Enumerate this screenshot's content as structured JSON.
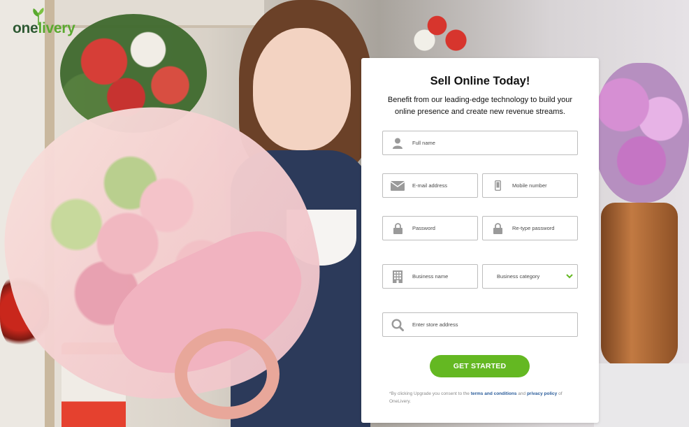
{
  "brand": {
    "logo_one": "one",
    "logo_livery": "livery",
    "colors": {
      "dark_green": "#2f5a34",
      "light_green": "#5aa92f",
      "button_green": "#64b822",
      "link_blue": "#2a5c9a"
    }
  },
  "form": {
    "title": "Sell Online Today!",
    "subtitle": "Benefit from our leading-edge technology to build your online presence and create new revenue streams.",
    "fields": {
      "full_name": {
        "placeholder": "Full name",
        "icon": "user-icon"
      },
      "email": {
        "placeholder": "E-mail address",
        "icon": "envelope-icon"
      },
      "mobile": {
        "placeholder": "Mobile number",
        "icon": "phone-icon"
      },
      "password": {
        "placeholder": "Password",
        "icon": "lock-icon"
      },
      "retype_password": {
        "placeholder": "Re-type password",
        "icon": "lock-icon"
      },
      "business_name": {
        "placeholder": "Business name",
        "icon": "building-icon"
      },
      "business_category": {
        "value": "Business category",
        "icon": "chevron-down-icon"
      },
      "store_address": {
        "placeholder": "Enter store address",
        "icon": "search-icon"
      }
    },
    "submit_label": "GET STARTED",
    "legal": {
      "prefix": "*By clicking Upgrade you consent to the",
      "terms_link": "terms and conditions",
      "and": "and",
      "privacy_link": "privacy policy",
      "suffix": "of OneLivery."
    }
  }
}
